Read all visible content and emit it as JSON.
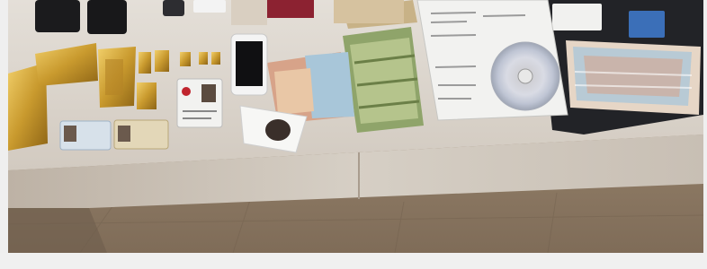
{
  "photo": {
    "scene": "table-with-seized-items",
    "colors": {
      "background": "#efefef",
      "table_top": "#dcd6cf",
      "table_front": "#cfc7bd",
      "floor": "#9c8a74",
      "gold": "#c99a2e",
      "euro_green": "#8fa46a",
      "lira_blue": "#a8c6d9",
      "lira_red": "#d7a389",
      "binder_dark": "#222327"
    },
    "objects": [
      "mobile-phone",
      "smartphone-white",
      "passport",
      "gold-bars",
      "id-card",
      "driver-license",
      "banknotes-euro",
      "banknotes-lira",
      "cd-disc",
      "document-binder",
      "photo-print"
    ]
  }
}
